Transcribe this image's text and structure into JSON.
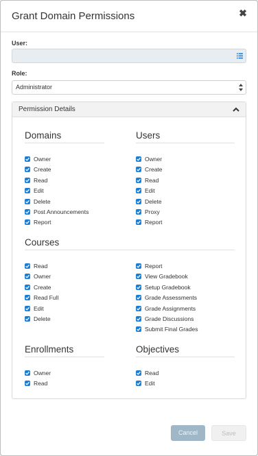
{
  "dialog": {
    "title": "Grant Domain Permissions",
    "close_icon": "times-icon"
  },
  "user": {
    "label": "User:",
    "value": "",
    "icon": "list-icon"
  },
  "role": {
    "label": "Role:",
    "value": "Administrator",
    "icon": "updown-icon"
  },
  "panel": {
    "title": "Permission Details",
    "icon": "chevron-up-icon"
  },
  "colors": {
    "checkbox": "#1a7fd4",
    "cancel_bg": "#9fb7c6",
    "user_bg": "#e8edf2"
  },
  "sections": {
    "domains": {
      "title": "Domains",
      "items": [
        "Owner",
        "Create",
        "Read",
        "Edit",
        "Delete",
        "Post Announcements",
        "Report"
      ]
    },
    "users": {
      "title": "Users",
      "items": [
        "Owner",
        "Create",
        "Read",
        "Edit",
        "Delete",
        "Proxy",
        "Report"
      ]
    },
    "courses": {
      "title": "Courses",
      "left_items": [
        "Read",
        "Owner",
        "Create",
        "Read Full",
        "Edit",
        "Delete"
      ],
      "right_items": [
        "Report",
        "View Gradebook",
        "Setup Gradebook",
        "Grade Assessments",
        "Grade Assignments",
        "Grade Discussions",
        "Submit Final Grades"
      ]
    },
    "enrollments": {
      "title": "Enrollments",
      "items": [
        "Owner",
        "Read"
      ]
    },
    "objectives": {
      "title": "Objectives",
      "items": [
        "Read",
        "Edit"
      ]
    }
  },
  "buttons": {
    "cancel": "Cancel",
    "save": "Save"
  }
}
